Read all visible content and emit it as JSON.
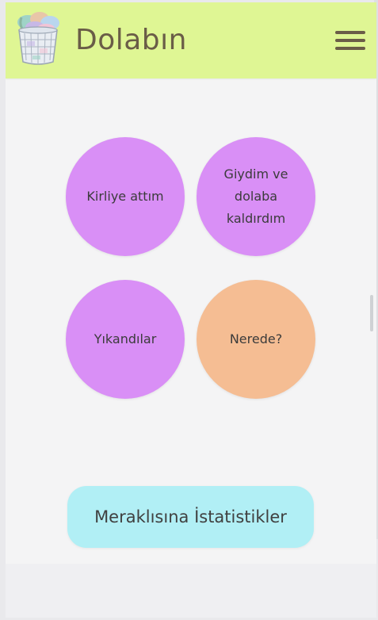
{
  "header": {
    "title": "Dolabın",
    "logo_icon": "laundry-basket-icon",
    "menu_icon": "hamburger-menu-icon",
    "background_color": "#dff694",
    "title_color": "#6a5d47"
  },
  "actions": [
    {
      "label": "Kirliye attım",
      "color": "#d98ff6"
    },
    {
      "label": "Giydim ve dolaba kaldırdım",
      "color": "#d98ff6"
    },
    {
      "label": "Yıkandılar",
      "color": "#d98ff6"
    },
    {
      "label": "Nerede?",
      "color": "#f5bd93"
    }
  ],
  "stats_button": {
    "label": "Meraklısına İstatistikler",
    "color": "#b1eff5"
  }
}
